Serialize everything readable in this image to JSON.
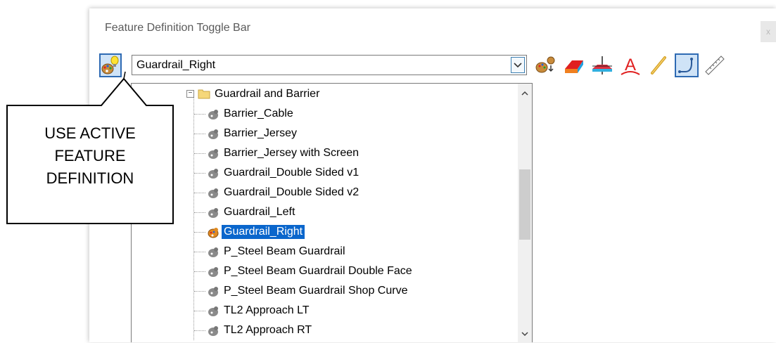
{
  "window": {
    "title": "Feature Definition Toggle Bar",
    "close_label": "x"
  },
  "toolbar": {
    "active_feature_icon": "palette-lightbulb-icon",
    "selected_feature": "Guardrail_Right",
    "tools": [
      {
        "name": "match-feature-icon"
      },
      {
        "name": "surface-template-icon"
      },
      {
        "name": "cross-section-icon"
      },
      {
        "name": "text-style-icon"
      },
      {
        "name": "linear-element-icon"
      },
      {
        "name": "civil-toggle-icon"
      },
      {
        "name": "ruler-icon"
      }
    ],
    "accent": "#2e6ab3",
    "selected_bg": "#cfe3f7"
  },
  "tree": {
    "folder": {
      "label": "Guardrail and Barrier",
      "expander": "−"
    },
    "items": [
      {
        "label": "Barrier_Cable",
        "selected": false
      },
      {
        "label": "Barrier_Jersey",
        "selected": false
      },
      {
        "label": "Barrier_Jersey with Screen",
        "selected": false
      },
      {
        "label": "Guardrail_Double Sided v1",
        "selected": false
      },
      {
        "label": "Guardrail_Double Sided v2",
        "selected": false
      },
      {
        "label": "Guardrail_Left",
        "selected": false
      },
      {
        "label": "Guardrail_Right",
        "selected": true
      },
      {
        "label": "P_Steel Beam Guardrail",
        "selected": false
      },
      {
        "label": "P_Steel Beam Guardrail Double Face",
        "selected": false
      },
      {
        "label": "P_Steel Beam Guardrail Shop Curve",
        "selected": false
      },
      {
        "label": "TL2 Approach LT",
        "selected": false
      },
      {
        "label": "TL2 Approach RT",
        "selected": false
      }
    ],
    "selection_color": "#0a66cc"
  },
  "callout": {
    "line1": "USE ACTIVE",
    "line2": "FEATURE",
    "line3": "DEFINITION"
  }
}
